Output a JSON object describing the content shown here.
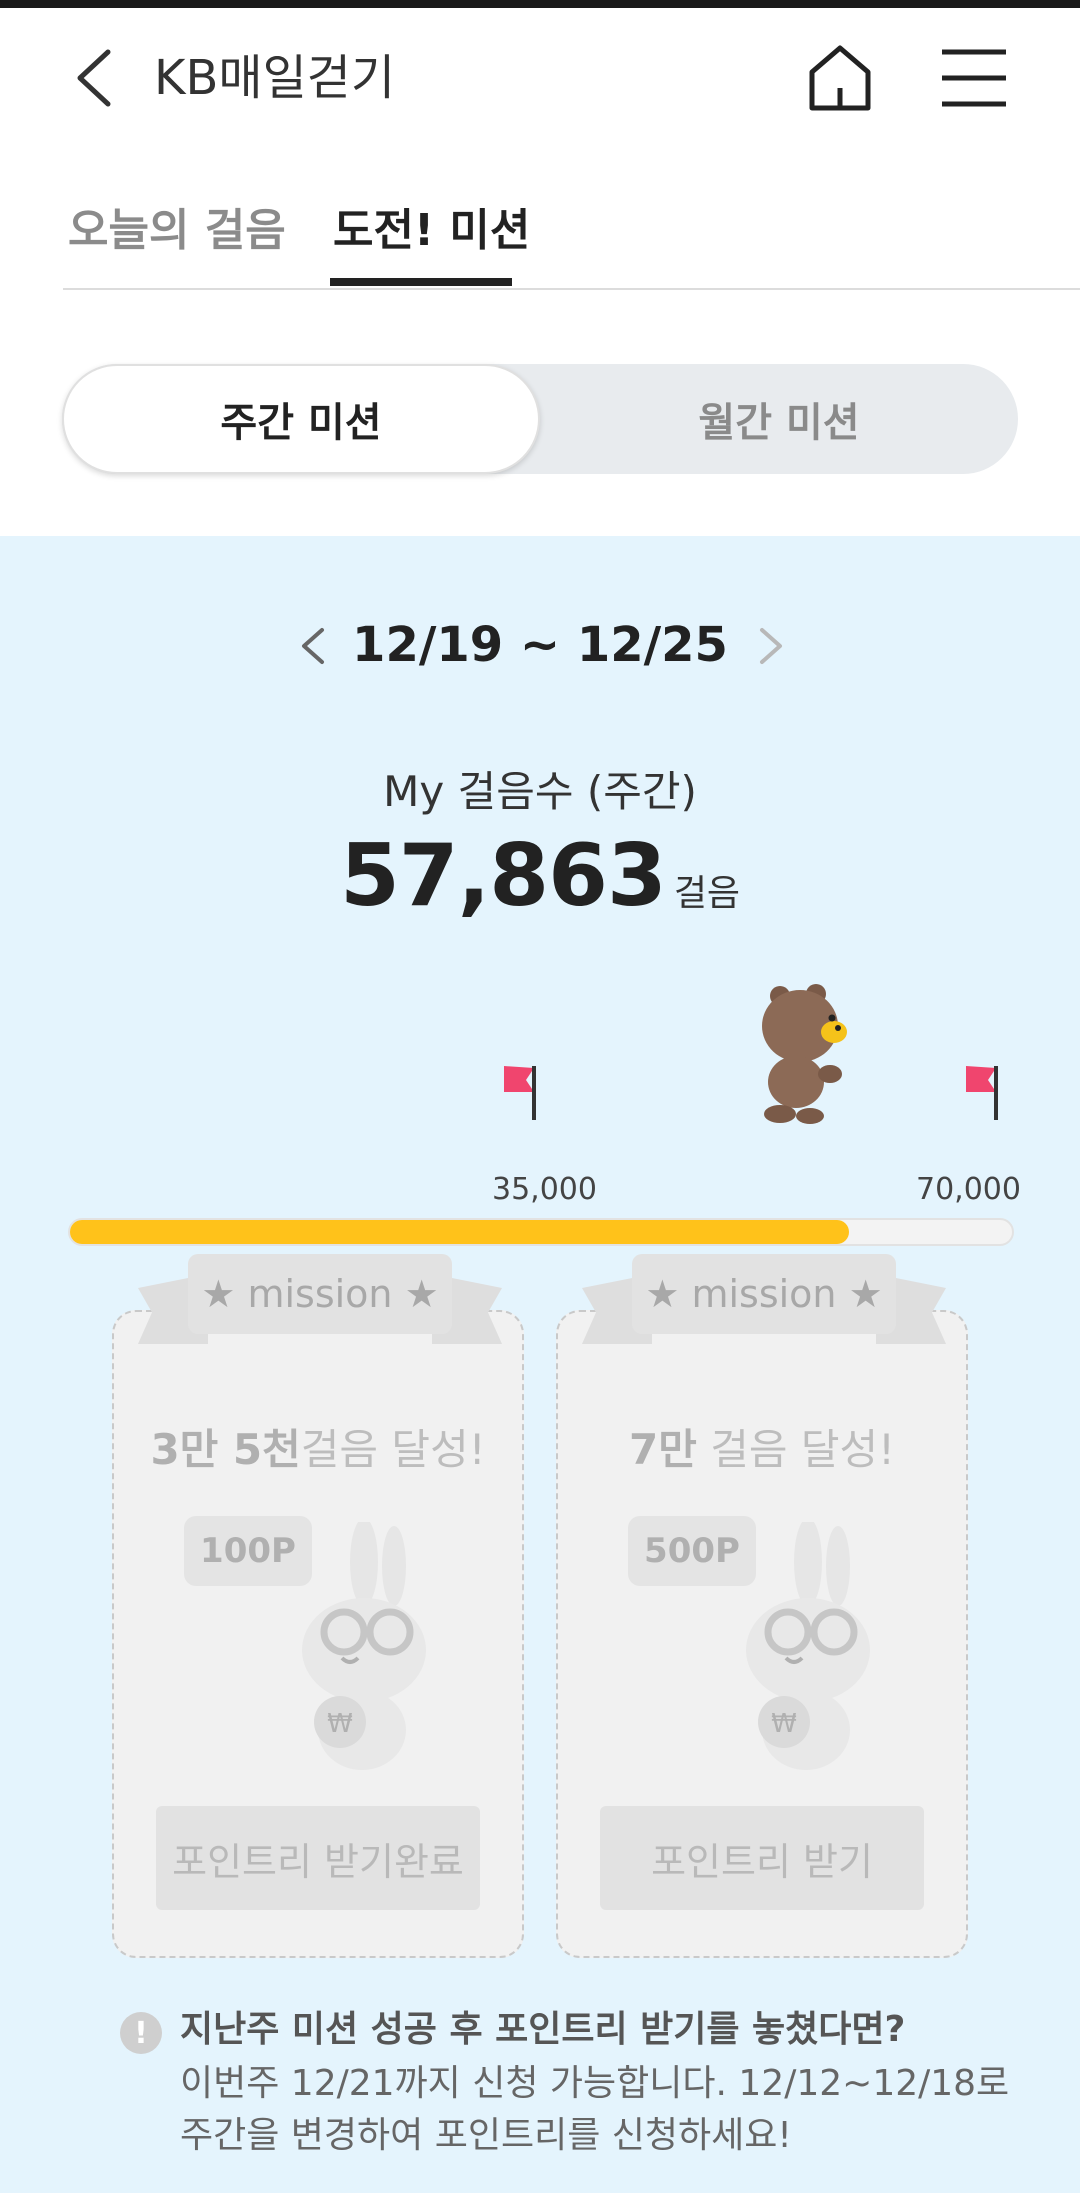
{
  "header": {
    "title": "KB매일걷기"
  },
  "tabs": {
    "today": "오늘의 걸음",
    "mission": "도전! 미션"
  },
  "segment": {
    "weekly": "주간 미션",
    "monthly": "월간 미션"
  },
  "week": {
    "range": "12/19 ~ 12/25"
  },
  "steps": {
    "label": "My 걸음수 (주간)",
    "value": "57,863",
    "unit": "걸음",
    "progress_fraction": 0.827
  },
  "milestones": {
    "mid": "35,000",
    "end": "70,000"
  },
  "cards": [
    {
      "ribbon": "★ mission ★",
      "title_bold": "3만 5천",
      "title_rest": "걸음 달성!",
      "reward": "100P",
      "button": "포인트리 받기완료"
    },
    {
      "ribbon": "★ mission ★",
      "title_bold": "7만",
      "title_rest": " 걸음 달성!",
      "reward": "500P",
      "button": "포인트리 받기"
    }
  ],
  "notice": {
    "title": "지난주 미션 성공 후 포인트리 받기를 놓쳤다면?",
    "body": "이번주 12/21까지 신청 가능합니다. 12/12~12/18로 주간을 변경하여 포인트리를 신청하세요!"
  },
  "colors": {
    "accent": "#ffc21a",
    "background": "#e4f4fd",
    "flag": "#f0456e"
  }
}
